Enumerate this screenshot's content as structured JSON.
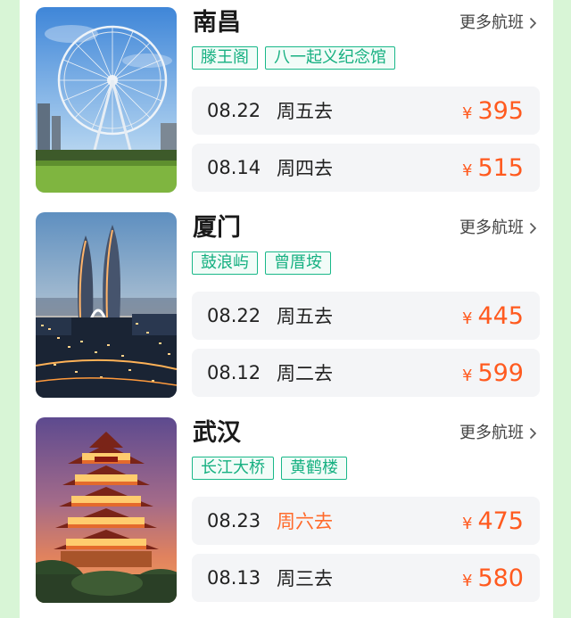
{
  "colors": {
    "accent_green": "#19b889",
    "price_orange": "#ff5a1f",
    "page_bg": "#d8f5d6"
  },
  "more_label": "更多航班",
  "currency": "¥",
  "cards": [
    {
      "city": "南昌",
      "image_icon": "ferris-wheel-photo",
      "tags": [
        "滕王阁",
        "八一起义纪念馆"
      ],
      "flights": [
        {
          "date": "08.22",
          "weekday": "周五去",
          "price": "395"
        },
        {
          "date": "08.14",
          "weekday": "周四去",
          "price": "515"
        }
      ]
    },
    {
      "city": "厦门",
      "image_icon": "twin-towers-night-photo",
      "tags": [
        "鼓浪屿",
        "曾厝垵"
      ],
      "flights": [
        {
          "date": "08.22",
          "weekday": "周五去",
          "price": "445"
        },
        {
          "date": "08.12",
          "weekday": "周二去",
          "price": "599"
        }
      ]
    },
    {
      "city": "武汉",
      "image_icon": "yellow-crane-tower-photo",
      "tags": [
        "长江大桥",
        "黄鹤楼"
      ],
      "flights": [
        {
          "date": "08.23",
          "weekday": "周六去",
          "price": "475",
          "weekday_highlight": true
        },
        {
          "date": "08.13",
          "weekday": "周三去",
          "price": "580"
        }
      ]
    }
  ]
}
